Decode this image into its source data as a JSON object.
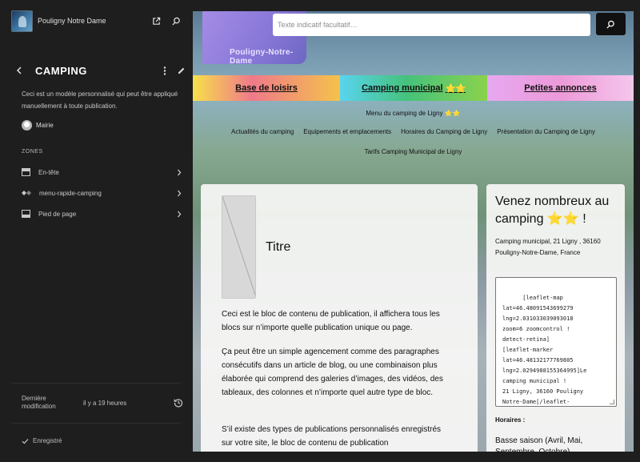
{
  "sidebar": {
    "site_title": "Pouligny Notre Dame",
    "icons": {
      "site": "site-logo",
      "external": "external-link-icon",
      "search": "search-icon",
      "back": "chevron-left-icon",
      "more": "more-vertical-icon",
      "edit": "pencil-icon"
    },
    "template_title": "CAMPING",
    "description": "Ceci est un modèle personnalisé qui peut être appliqué manuellement à toute publication.",
    "author": "Mairie",
    "zones_heading": "ZONES",
    "zones": [
      {
        "label": "En-tête",
        "icon": "header-layout-icon"
      },
      {
        "label": "menu-rapide-camping",
        "icon": "diamond-icon"
      },
      {
        "label": "Pied de page",
        "icon": "footer-layout-icon"
      }
    ],
    "last_modified_label": "Dernière modification",
    "last_modified_value": "il y a 19 heures",
    "saved_label": "Enregistré"
  },
  "canvas": {
    "logo_text": "Pouligny-Notre-Dame",
    "search_placeholder": "Texte indicatif facultatif…",
    "nav": [
      {
        "label": "Base de loisirs",
        "stars": ""
      },
      {
        "label": "Camping municipal",
        "stars": "⭐⭐"
      },
      {
        "label": "Petites annonces",
        "stars": ""
      }
    ],
    "submenu_title": "Menu du camping de Ligny ⭐⭐",
    "submenu_row1": [
      "Actualités du camping",
      "Equipements et emplacements",
      "Horaires du Camping de Ligny",
      "Présentation du Camping de Ligny"
    ],
    "submenu_row2": [
      "Tarifs Camping Municipal de Ligny"
    ],
    "main": {
      "title": "Titre",
      "paragraphs": [
        "Ceci est le bloc de contenu de publication, il affichera tous les blocs sur n’importe quelle publication unique ou page.",
        "Ça peut être un simple agencement comme des paragraphes consécutifs dans un article de blog, ou une combinaison plus élaborée qui comprend des galeries d’images, des vidéos, des tableaux, des colonnes et n’importe quel autre type de bloc.",
        "S’il existe des types de publications personnalisés enregistrés sur votre site, le bloc de contenu de publication"
      ]
    },
    "side": {
      "title": "Venez nombreux au camping ⭐⭐ !",
      "address": "Camping municipal, 21 Ligny , 36160 Pouligny-Notre-Dame, France",
      "code": "[leaflet-map\nlat=46.48091543699279\nlng=2.031033039093018\nzoom=6 zoomcontrol !\ndetect-retina]\n[leaflet-marker\nlat=46.48132177769805\nlng=2.0294988155364995]Le\ncamping municipal !\n21 Ligny, 36160 Pouligny\nNotre-Dame[/leaflet-\nmarker]",
      "hours_heading": "Horaires :",
      "hours": "Basse saison (Avril, Mai, Septembre, Octobre)"
    }
  }
}
